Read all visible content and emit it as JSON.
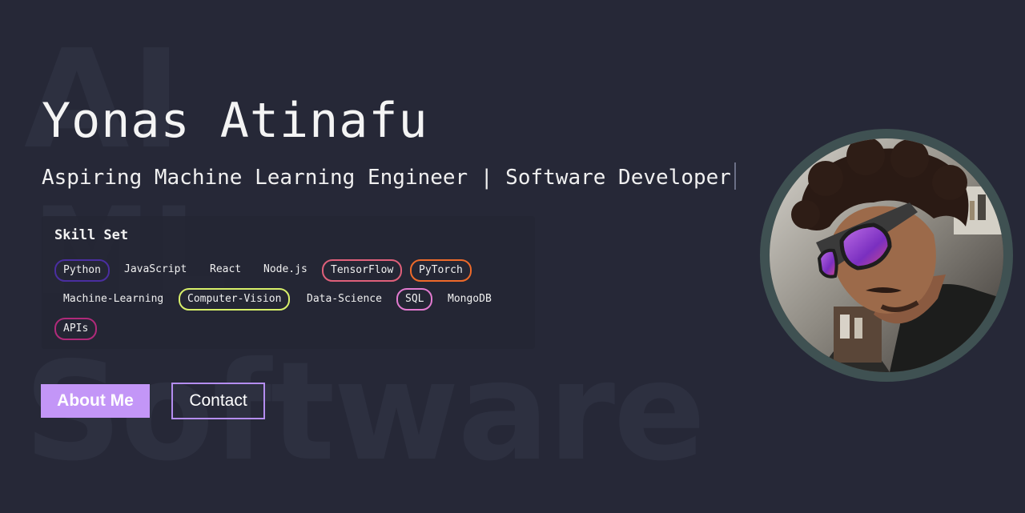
{
  "background_words": [
    "AI",
    "ML",
    "Software"
  ],
  "hero": {
    "name": "Yonas Atinafu",
    "subtitle": "Aspiring Machine Learning Engineer | Software Developer"
  },
  "skills": {
    "title": "Skill Set",
    "items": [
      {
        "label": "Python",
        "border": "#4a2ea0"
      },
      {
        "label": "JavaScript",
        "border": ""
      },
      {
        "label": "React",
        "border": ""
      },
      {
        "label": "Node.js",
        "border": ""
      },
      {
        "label": "TensorFlow",
        "border": "#e0607a"
      },
      {
        "label": "PyTorch",
        "border": "#ee6a2a"
      },
      {
        "label": "Machine-Learning",
        "border": ""
      },
      {
        "label": "Computer-Vision",
        "border": "#d8f06a"
      },
      {
        "label": "Data-Science",
        "border": ""
      },
      {
        "label": "SQL",
        "border": "#e27ad0"
      },
      {
        "label": "MongoDB",
        "border": ""
      },
      {
        "label": "APIs",
        "border": "#b02a7a"
      }
    ]
  },
  "buttons": {
    "about": "About Me",
    "contact": "Contact"
  },
  "colors": {
    "background": "#262837",
    "accent": "#c396f7",
    "avatar_ring": "#3f5152"
  }
}
